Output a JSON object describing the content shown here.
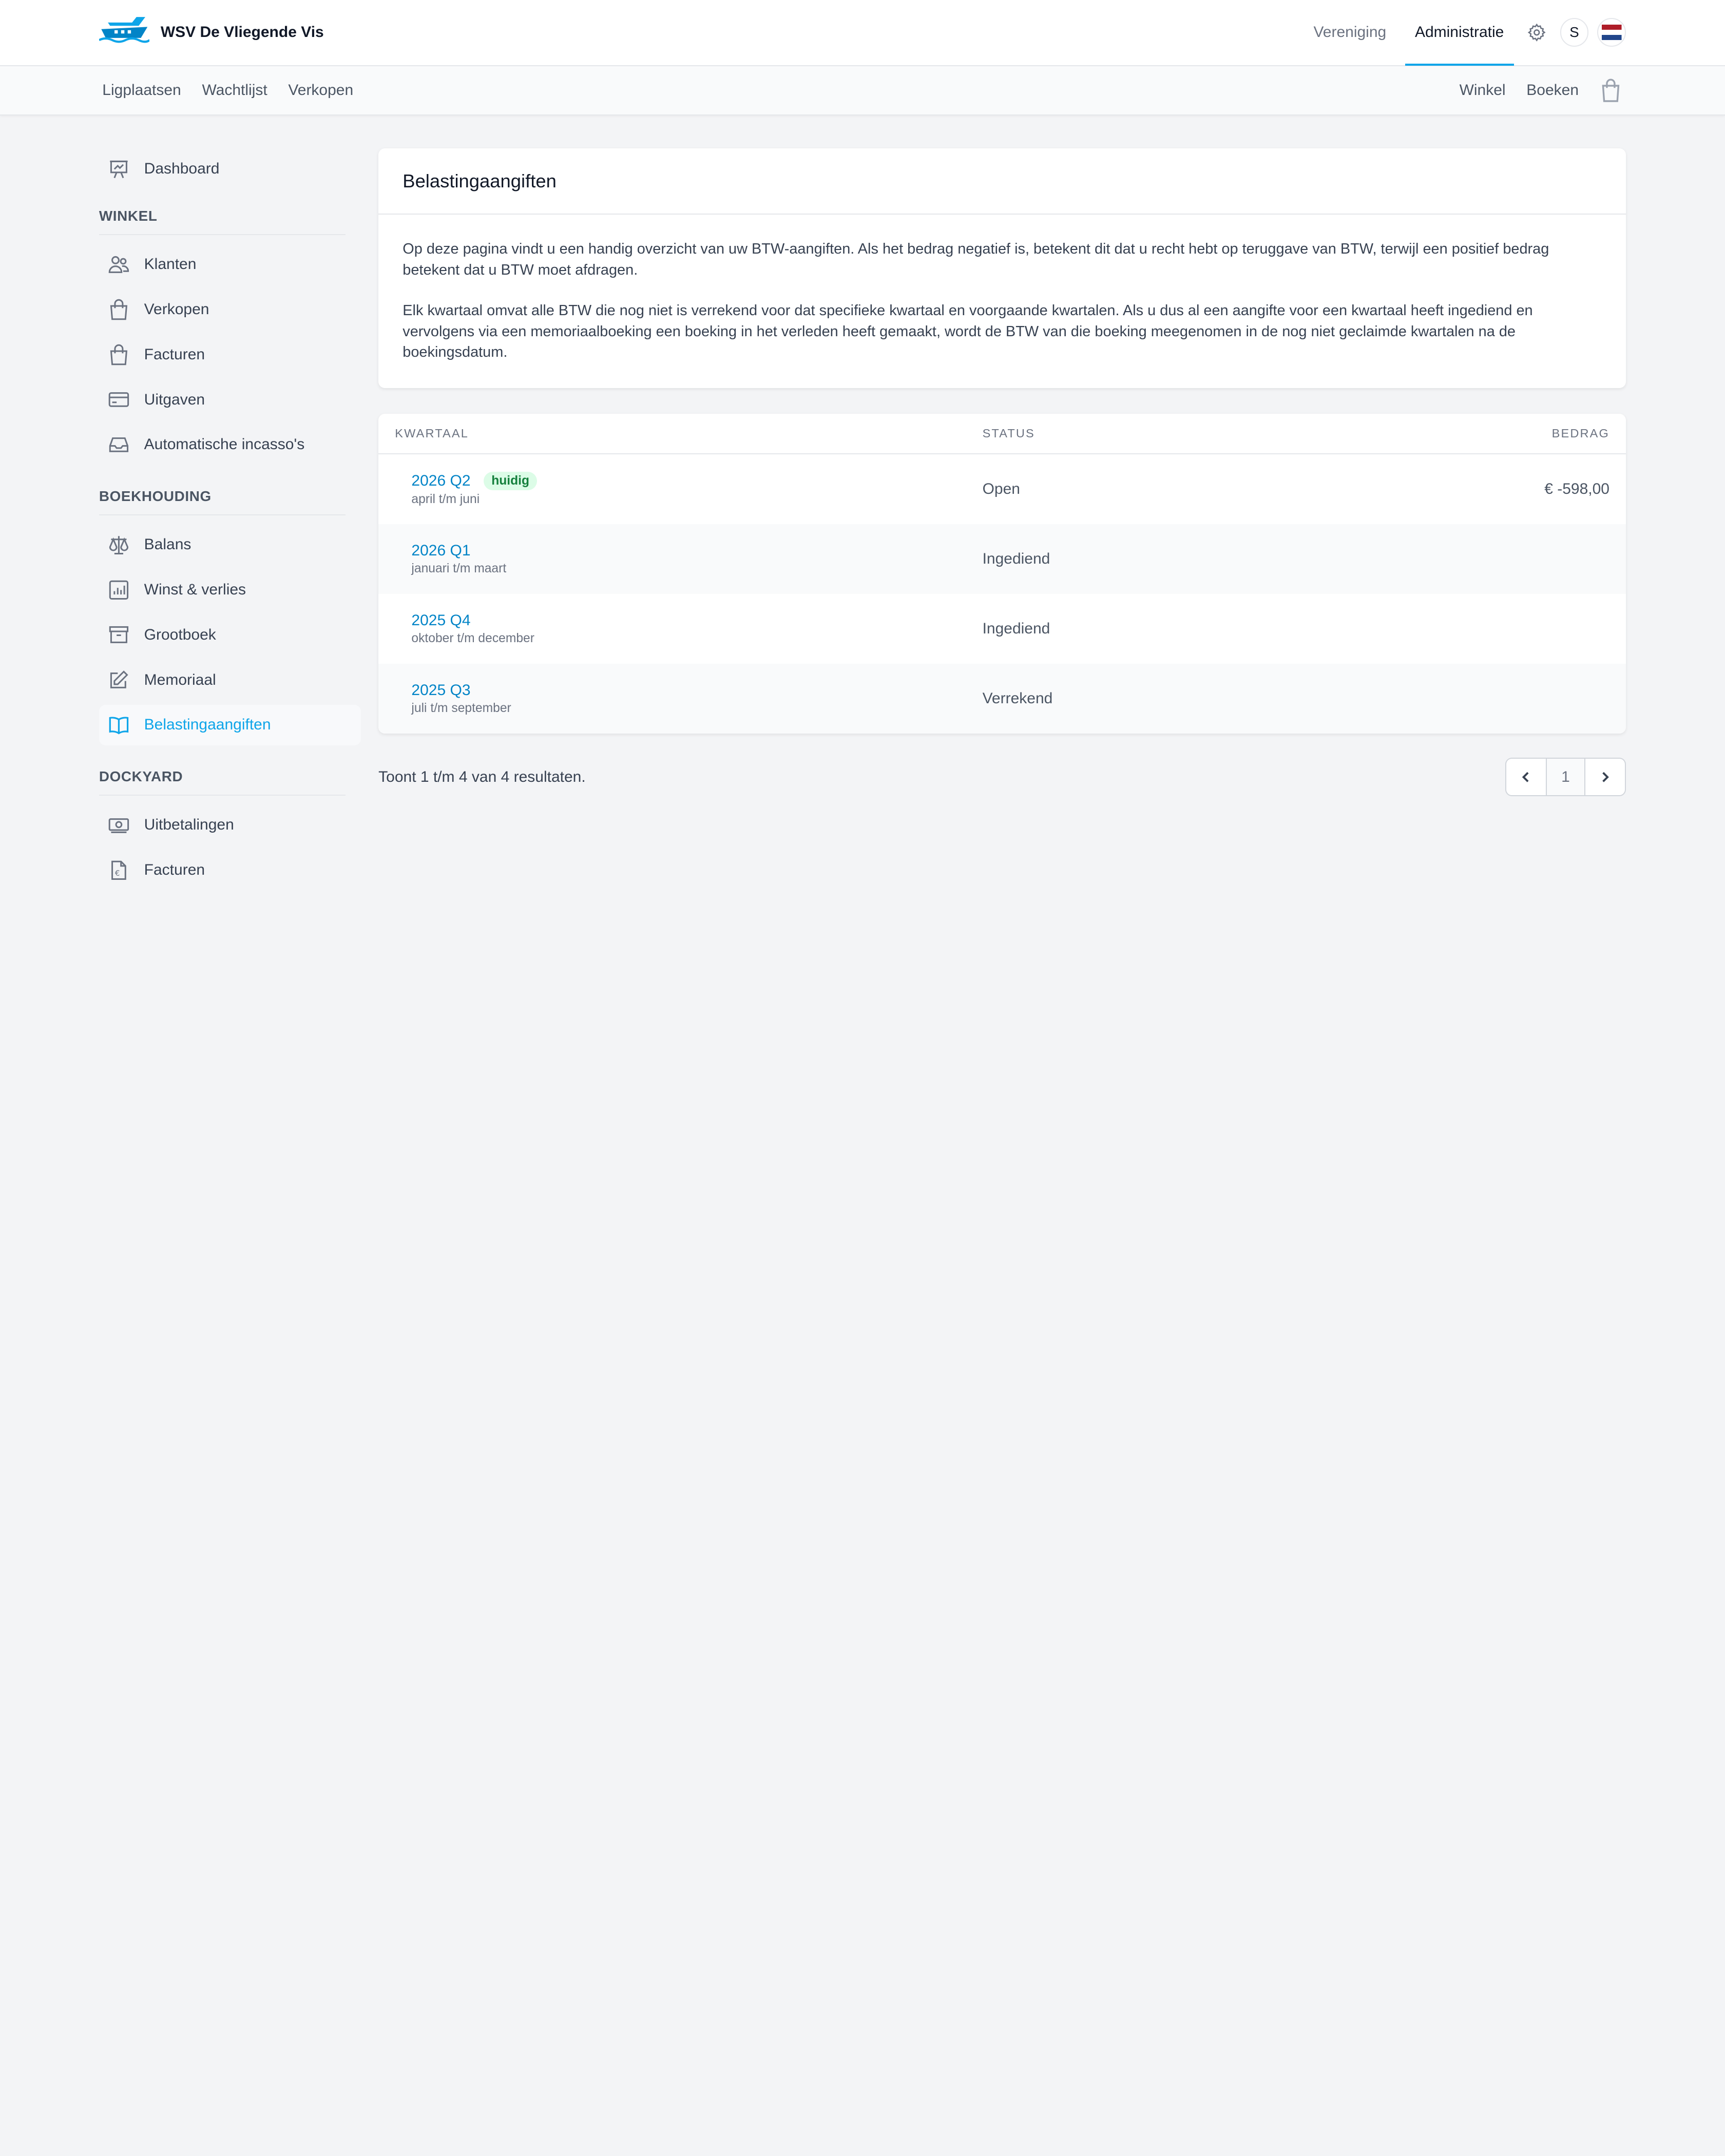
{
  "header": {
    "brand": "WSV De Vliegende Vis",
    "nav": [
      "Vereniging",
      "Administratie"
    ],
    "active_nav": "Administratie",
    "avatar_initial": "S"
  },
  "subnav": {
    "left": [
      "Ligplaatsen",
      "Wachtlijst",
      "Verkopen"
    ],
    "right": [
      "Winkel",
      "Boeken"
    ]
  },
  "sidebar": {
    "top": {
      "label": "Dashboard",
      "icon": "chart-board-icon"
    },
    "sections": [
      {
        "heading": "WINKEL",
        "items": [
          {
            "label": "Klanten",
            "icon": "users-icon"
          },
          {
            "label": "Verkopen",
            "icon": "shopping-bag-icon"
          },
          {
            "label": "Facturen",
            "icon": "shopping-bag-icon"
          },
          {
            "label": "Uitgaven",
            "icon": "credit-card-icon"
          },
          {
            "label": "Automatische incasso's",
            "icon": "inbox-icon"
          }
        ]
      },
      {
        "heading": "BOEKHOUDING",
        "items": [
          {
            "label": "Balans",
            "icon": "scale-icon"
          },
          {
            "label": "Winst & verlies",
            "icon": "bar-chart-icon"
          },
          {
            "label": "Grootboek",
            "icon": "archive-box-icon"
          },
          {
            "label": "Memoriaal",
            "icon": "pencil-square-icon"
          },
          {
            "label": "Belastingaangiften",
            "icon": "book-open-icon",
            "active": true
          }
        ]
      },
      {
        "heading": "DOCKYARD",
        "items": [
          {
            "label": "Uitbetalingen",
            "icon": "banknotes-icon"
          },
          {
            "label": "Facturen",
            "icon": "document-euro-icon"
          }
        ]
      }
    ]
  },
  "page": {
    "title": "Belastingaangiften",
    "paragraph1": "Op deze pagina vindt u een handig overzicht van uw BTW-aangiften. Als het bedrag negatief is, betekent dit dat u recht hebt op teruggave van BTW, terwijl een positief bedrag betekent dat u BTW moet afdragen.",
    "paragraph2": "Elk kwartaal omvat alle BTW die nog niet is verrekend voor dat specifieke kwartaal en voorgaande kwartalen. Als u dus al een aangifte voor een kwartaal heeft ingediend en vervolgens via een memoriaalboeking een boeking in het verleden heeft gemaakt, wordt de BTW van die boeking meegenomen in de nog niet geclaimde kwartalen na de boekingsdatum."
  },
  "table": {
    "headers": {
      "quarter": "KWARTAAL",
      "status": "STATUS",
      "amount": "BEDRAG"
    },
    "rows": [
      {
        "quarter": "2026 Q2",
        "badge": "huidig",
        "period": "april t/m juni",
        "status": "Open",
        "amount": "€ -598,00"
      },
      {
        "quarter": "2026 Q1",
        "badge": "",
        "period": "januari t/m maart",
        "status": "Ingediend",
        "amount": ""
      },
      {
        "quarter": "2025 Q4",
        "badge": "",
        "period": "oktober t/m december",
        "status": "Ingediend",
        "amount": ""
      },
      {
        "quarter": "2025 Q3",
        "badge": "",
        "period": "juli t/m september",
        "status": "Verrekend",
        "amount": ""
      }
    ]
  },
  "pagination": {
    "summary": "Toont 1 t/m 4 van 4 resultaten.",
    "current_page": "1"
  },
  "colors": {
    "accent": "#0ea5e9",
    "link": "#0284c7",
    "badge_bg": "#dcfce7",
    "badge_text": "#15803d"
  }
}
